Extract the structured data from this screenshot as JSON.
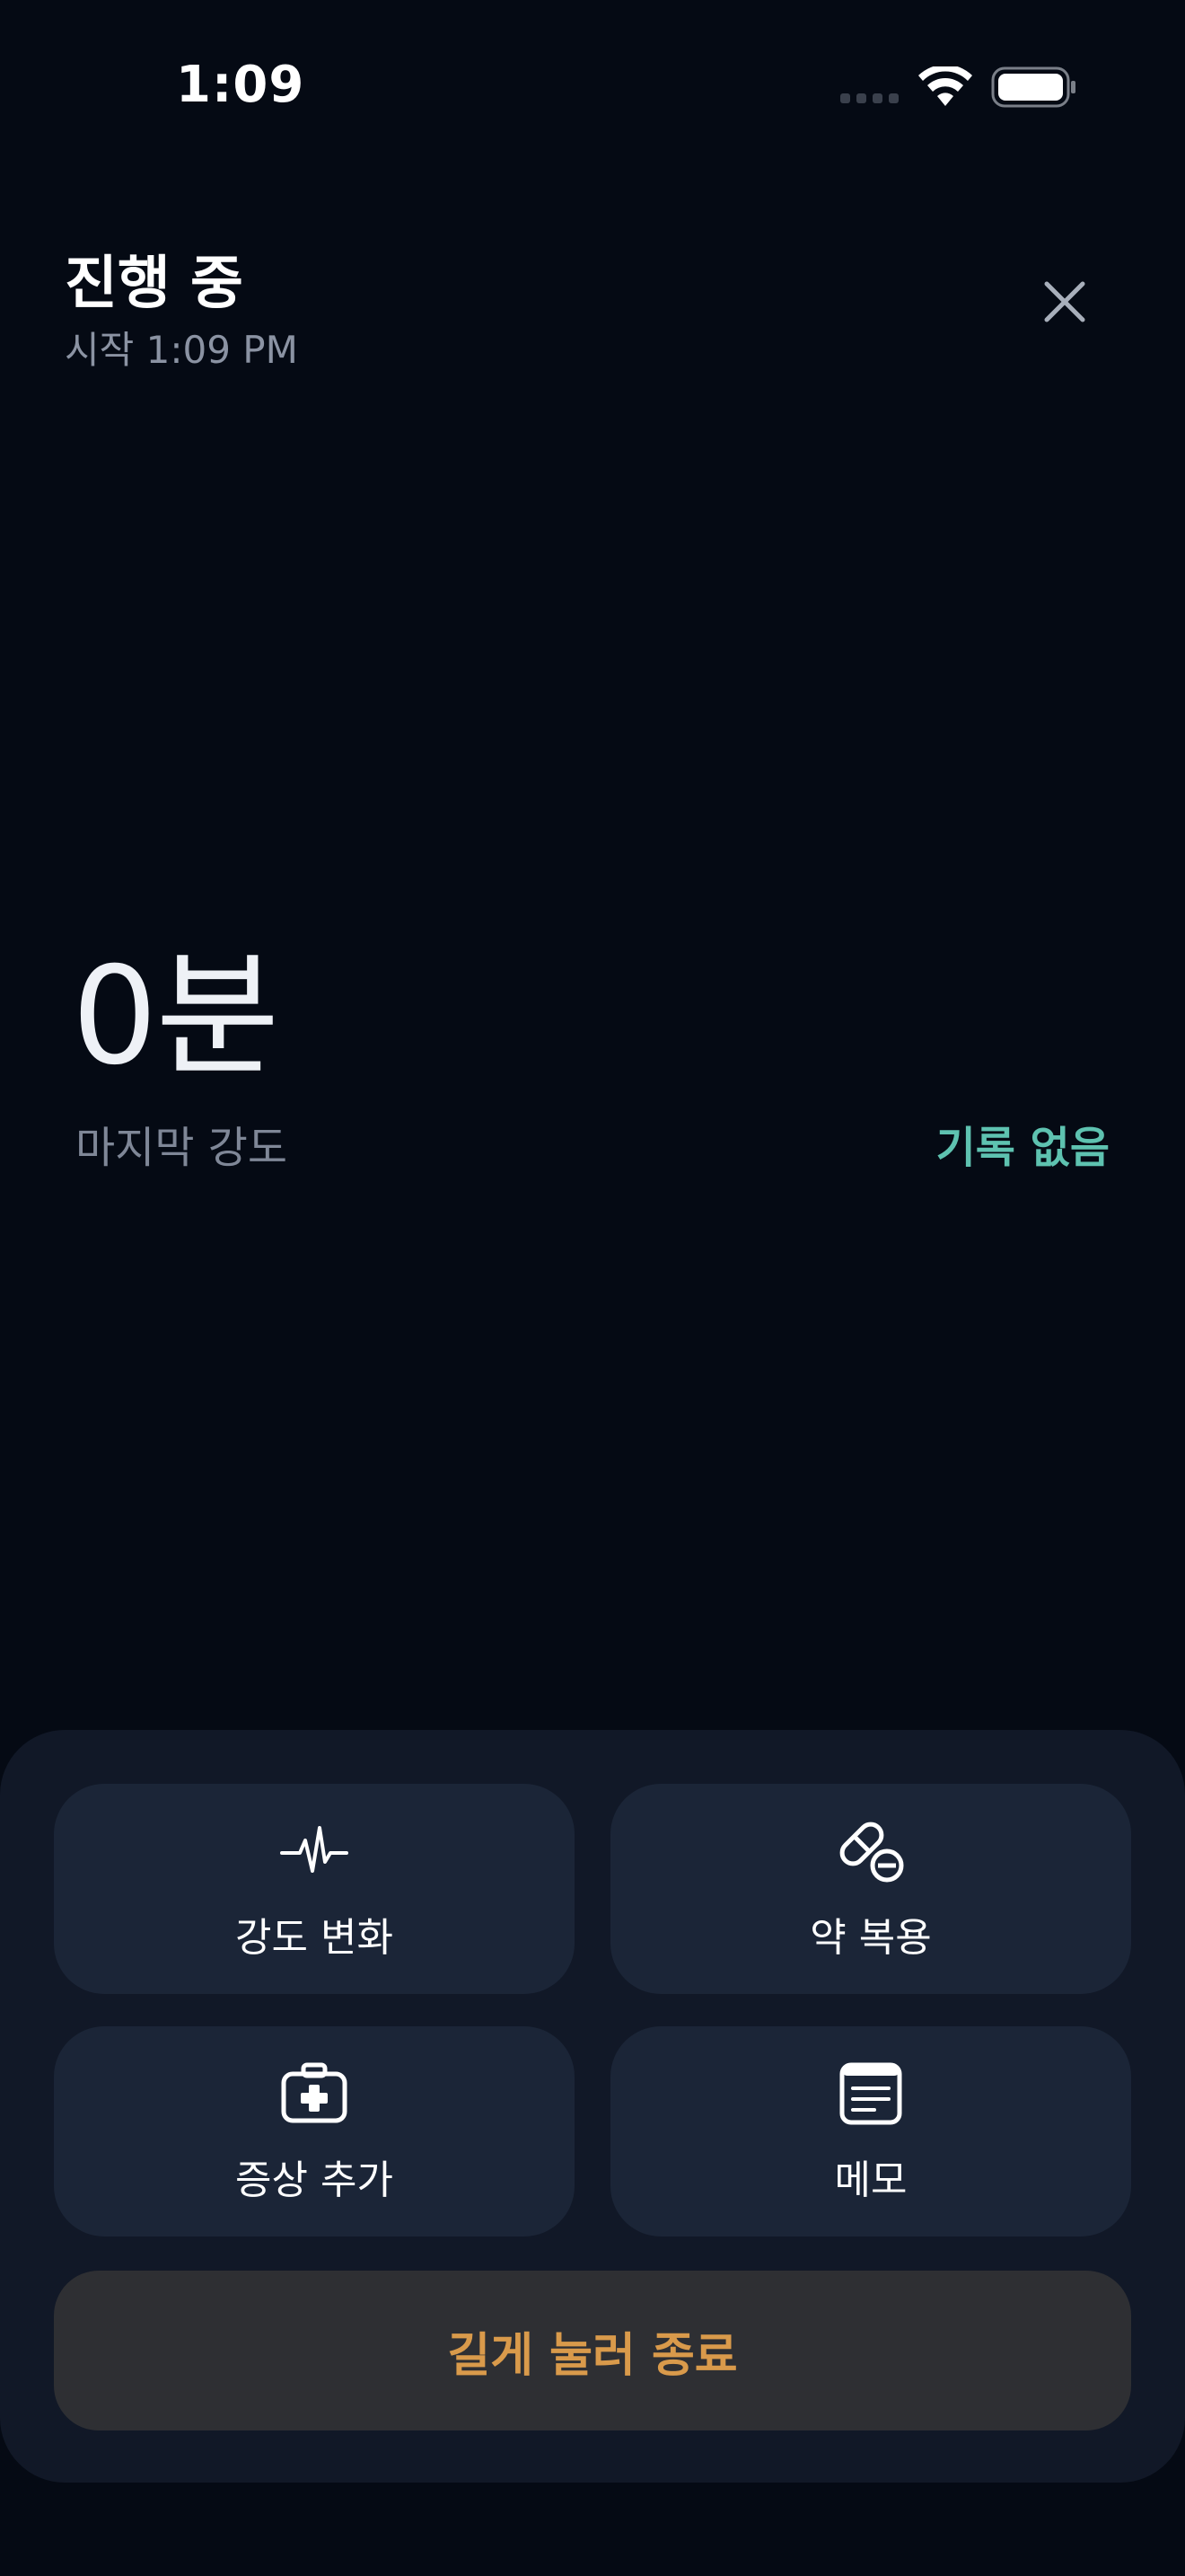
{
  "status_bar": {
    "time": "1:09"
  },
  "header": {
    "title": "진행 중",
    "subtitle": "시작 1:09 PM"
  },
  "session": {
    "elapsed": "0분",
    "last_intensity_label": "마지막 강도",
    "last_intensity_value": "기록 없음"
  },
  "actions": {
    "intensity_change": "강도 변화",
    "medication": "약 복용",
    "add_symptom": "증상 추가",
    "memo": "메모",
    "end_session": "길게 눌러 종료"
  },
  "colors": {
    "background": "#050a14",
    "panel": "#111827",
    "button": "#1b2537",
    "accent_teal": "#5ec2b0",
    "accent_orange": "#d99a4b"
  }
}
